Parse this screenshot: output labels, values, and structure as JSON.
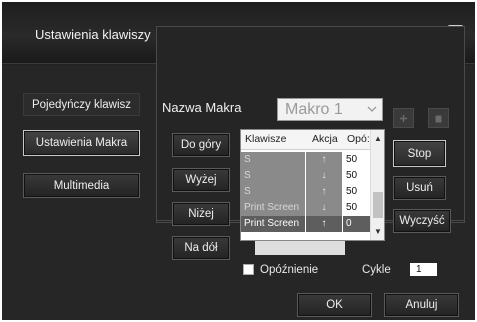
{
  "window": {
    "title": "Ustawienia klawiszy"
  },
  "sidebar": {
    "items": [
      {
        "label": "Pojedyńczy klawisz"
      },
      {
        "label": "Ustawienia Makra"
      },
      {
        "label": "Multimedia"
      }
    ]
  },
  "macro": {
    "name_label": "Nazwa Makra",
    "selected": "Makro 1",
    "move_buttons": {
      "top": "Do góry",
      "up": "Wyżej",
      "down": "Niżej",
      "bottom": "Na dół"
    },
    "table": {
      "headers": {
        "key": "Klawisze",
        "action": "Akcja",
        "delay": "Opó:"
      },
      "rows": [
        {
          "key": "S",
          "action": "↑",
          "delay": "50"
        },
        {
          "key": "S",
          "action": "↓",
          "delay": "50"
        },
        {
          "key": "S",
          "action": "↑",
          "delay": "50"
        },
        {
          "key": "Print Screen",
          "action": "↓",
          "delay": "50"
        },
        {
          "key": "Print Screen",
          "action": "↑",
          "delay": "0"
        }
      ]
    },
    "right_buttons": {
      "stop": "Stop",
      "delete": "Usuń",
      "clear": "Wyczyść"
    },
    "delay_label": "Opóźnienie",
    "cycles_label": "Cykle",
    "cycles_value": "1"
  },
  "footer": {
    "ok": "OK",
    "cancel": "Anuluj"
  }
}
